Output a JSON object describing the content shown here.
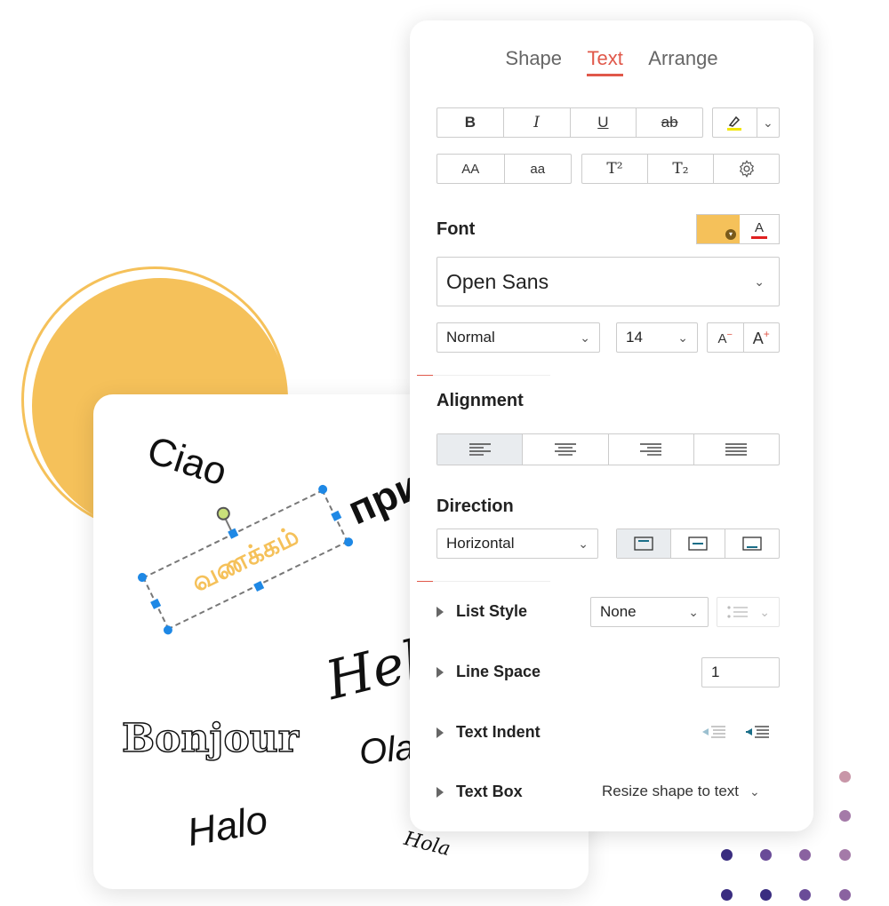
{
  "tabs": [
    "Shape",
    "Text",
    "Arrange"
  ],
  "active_tab": "Text",
  "format_buttons": {
    "bold": "B",
    "italic": "I",
    "underline": "U",
    "strike": "ab",
    "uppercase": "AA",
    "lowercase": "aa",
    "superscript": "T²",
    "subscript": "T₂"
  },
  "font": {
    "title": "Font",
    "family": "Open Sans",
    "weight": "Normal",
    "size": "14",
    "fill_color": "#F5C15A",
    "font_color": "#E02020"
  },
  "alignment": {
    "title": "Alignment",
    "selected": "left"
  },
  "direction": {
    "title": "Direction",
    "value": "Horizontal"
  },
  "list_style": {
    "label": "List Style",
    "value": "None"
  },
  "line_space": {
    "label": "Line Space",
    "value": "1"
  },
  "text_indent": {
    "label": "Text Indent"
  },
  "text_box": {
    "label": "Text Box",
    "value": "Resize shape to text"
  },
  "canvas_words": {
    "ciao": "Ciao",
    "privet": "прив",
    "vanakkam": "வணக்கம்",
    "hello": "Hell",
    "bonjour": "Bonjour",
    "ola": "Ola",
    "halo": "Halo",
    "hola": "Hola"
  },
  "colors": {
    "accent": "#E0584A",
    "highlight": "#F5C15A",
    "selection_handle": "#1E88E5"
  }
}
